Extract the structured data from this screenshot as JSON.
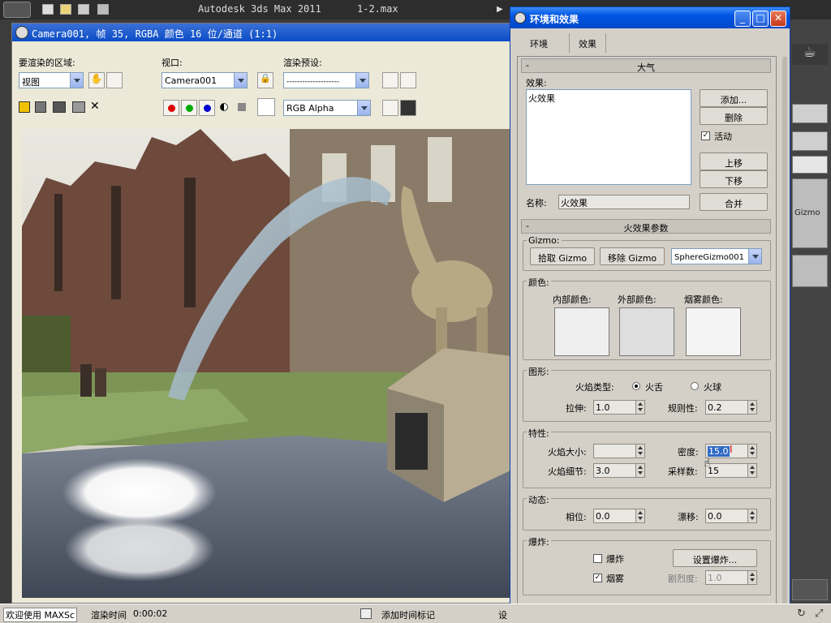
{
  "app": {
    "title": "Autodesk 3ds Max  2011",
    "file": "1-2.max"
  },
  "render_window": {
    "title": "Camera001, 帧 35, RGBA 颜色 16 位/通道 (1:1)",
    "area_label": "要渲染的区域:",
    "area_value": "视图",
    "viewport_label": "视口:",
    "viewport_value": "Camera001",
    "preset_label": "渲染预设:",
    "preset_value": "--------------------",
    "channel_value": "RGB Alpha"
  },
  "status_bar": {
    "welcome": "欢迎使用 MAXSc",
    "render_time_label": "渲染时间",
    "render_time_value": "0:00:02",
    "add_time_tag": "添加时间标记",
    "settings_label": "设"
  },
  "dialog": {
    "title": "环境和效果",
    "tabs": [
      "环境",
      "效果"
    ],
    "atmosphere": {
      "header": "大气",
      "effects_label": "效果:",
      "effects_list": [
        "火效果"
      ],
      "add_button": "添加...",
      "delete_button": "删除",
      "active_label": "活动",
      "active_checked": true,
      "move_up_button": "上移",
      "move_down_button": "下移",
      "name_label": "名称:",
      "name_value": "火效果",
      "merge_button": "合并"
    },
    "fire_params": {
      "header": "火效果参数",
      "gizmo_group": "Gizmo:",
      "pick_gizmo": "拾取 Gizmo",
      "remove_gizmo": "移除 Gizmo",
      "gizmo_value": "SphereGizmo001",
      "colors_group": "颜色:",
      "inner_color_label": "内部颜色:",
      "outer_color_label": "外部颜色:",
      "smoke_color_label": "烟雾颜色:",
      "inner_color": "#efefef",
      "outer_color": "#dedede",
      "smoke_color": "#f4f4f4",
      "shape_group": "图形:",
      "flame_type_label": "火焰类型:",
      "flame_type_tongue": "火舌",
      "flame_type_ball": "火球",
      "flame_type_selected": "火舌",
      "stretch_label": "拉伸:",
      "stretch_value": "1.0",
      "regularity_label": "规则性:",
      "regularity_value": "0.2",
      "characteristics_group": "特性:",
      "flame_size_label": "火焰大小:",
      "flame_size_value": "",
      "density_label": "密度:",
      "density_value": "15.0",
      "flame_detail_label": "火焰细节:",
      "flame_detail_value": "3.0",
      "samples_label": "采样数:",
      "samples_value": "15",
      "motion_group": "动态:",
      "phase_label": "相位:",
      "phase_value": "0.0",
      "drift_label": "漂移:",
      "drift_value": "0.0",
      "explosion_group": "爆炸:",
      "explosion_label": "爆炸",
      "explosion_checked": false,
      "setup_explosion_button": "设置爆炸...",
      "smoke_label": "烟雾",
      "smoke_checked": true,
      "fury_label": "剧烈度:",
      "fury_value": "1.0"
    }
  },
  "right_panel": {
    "gizmo_text": "Gizmo"
  }
}
